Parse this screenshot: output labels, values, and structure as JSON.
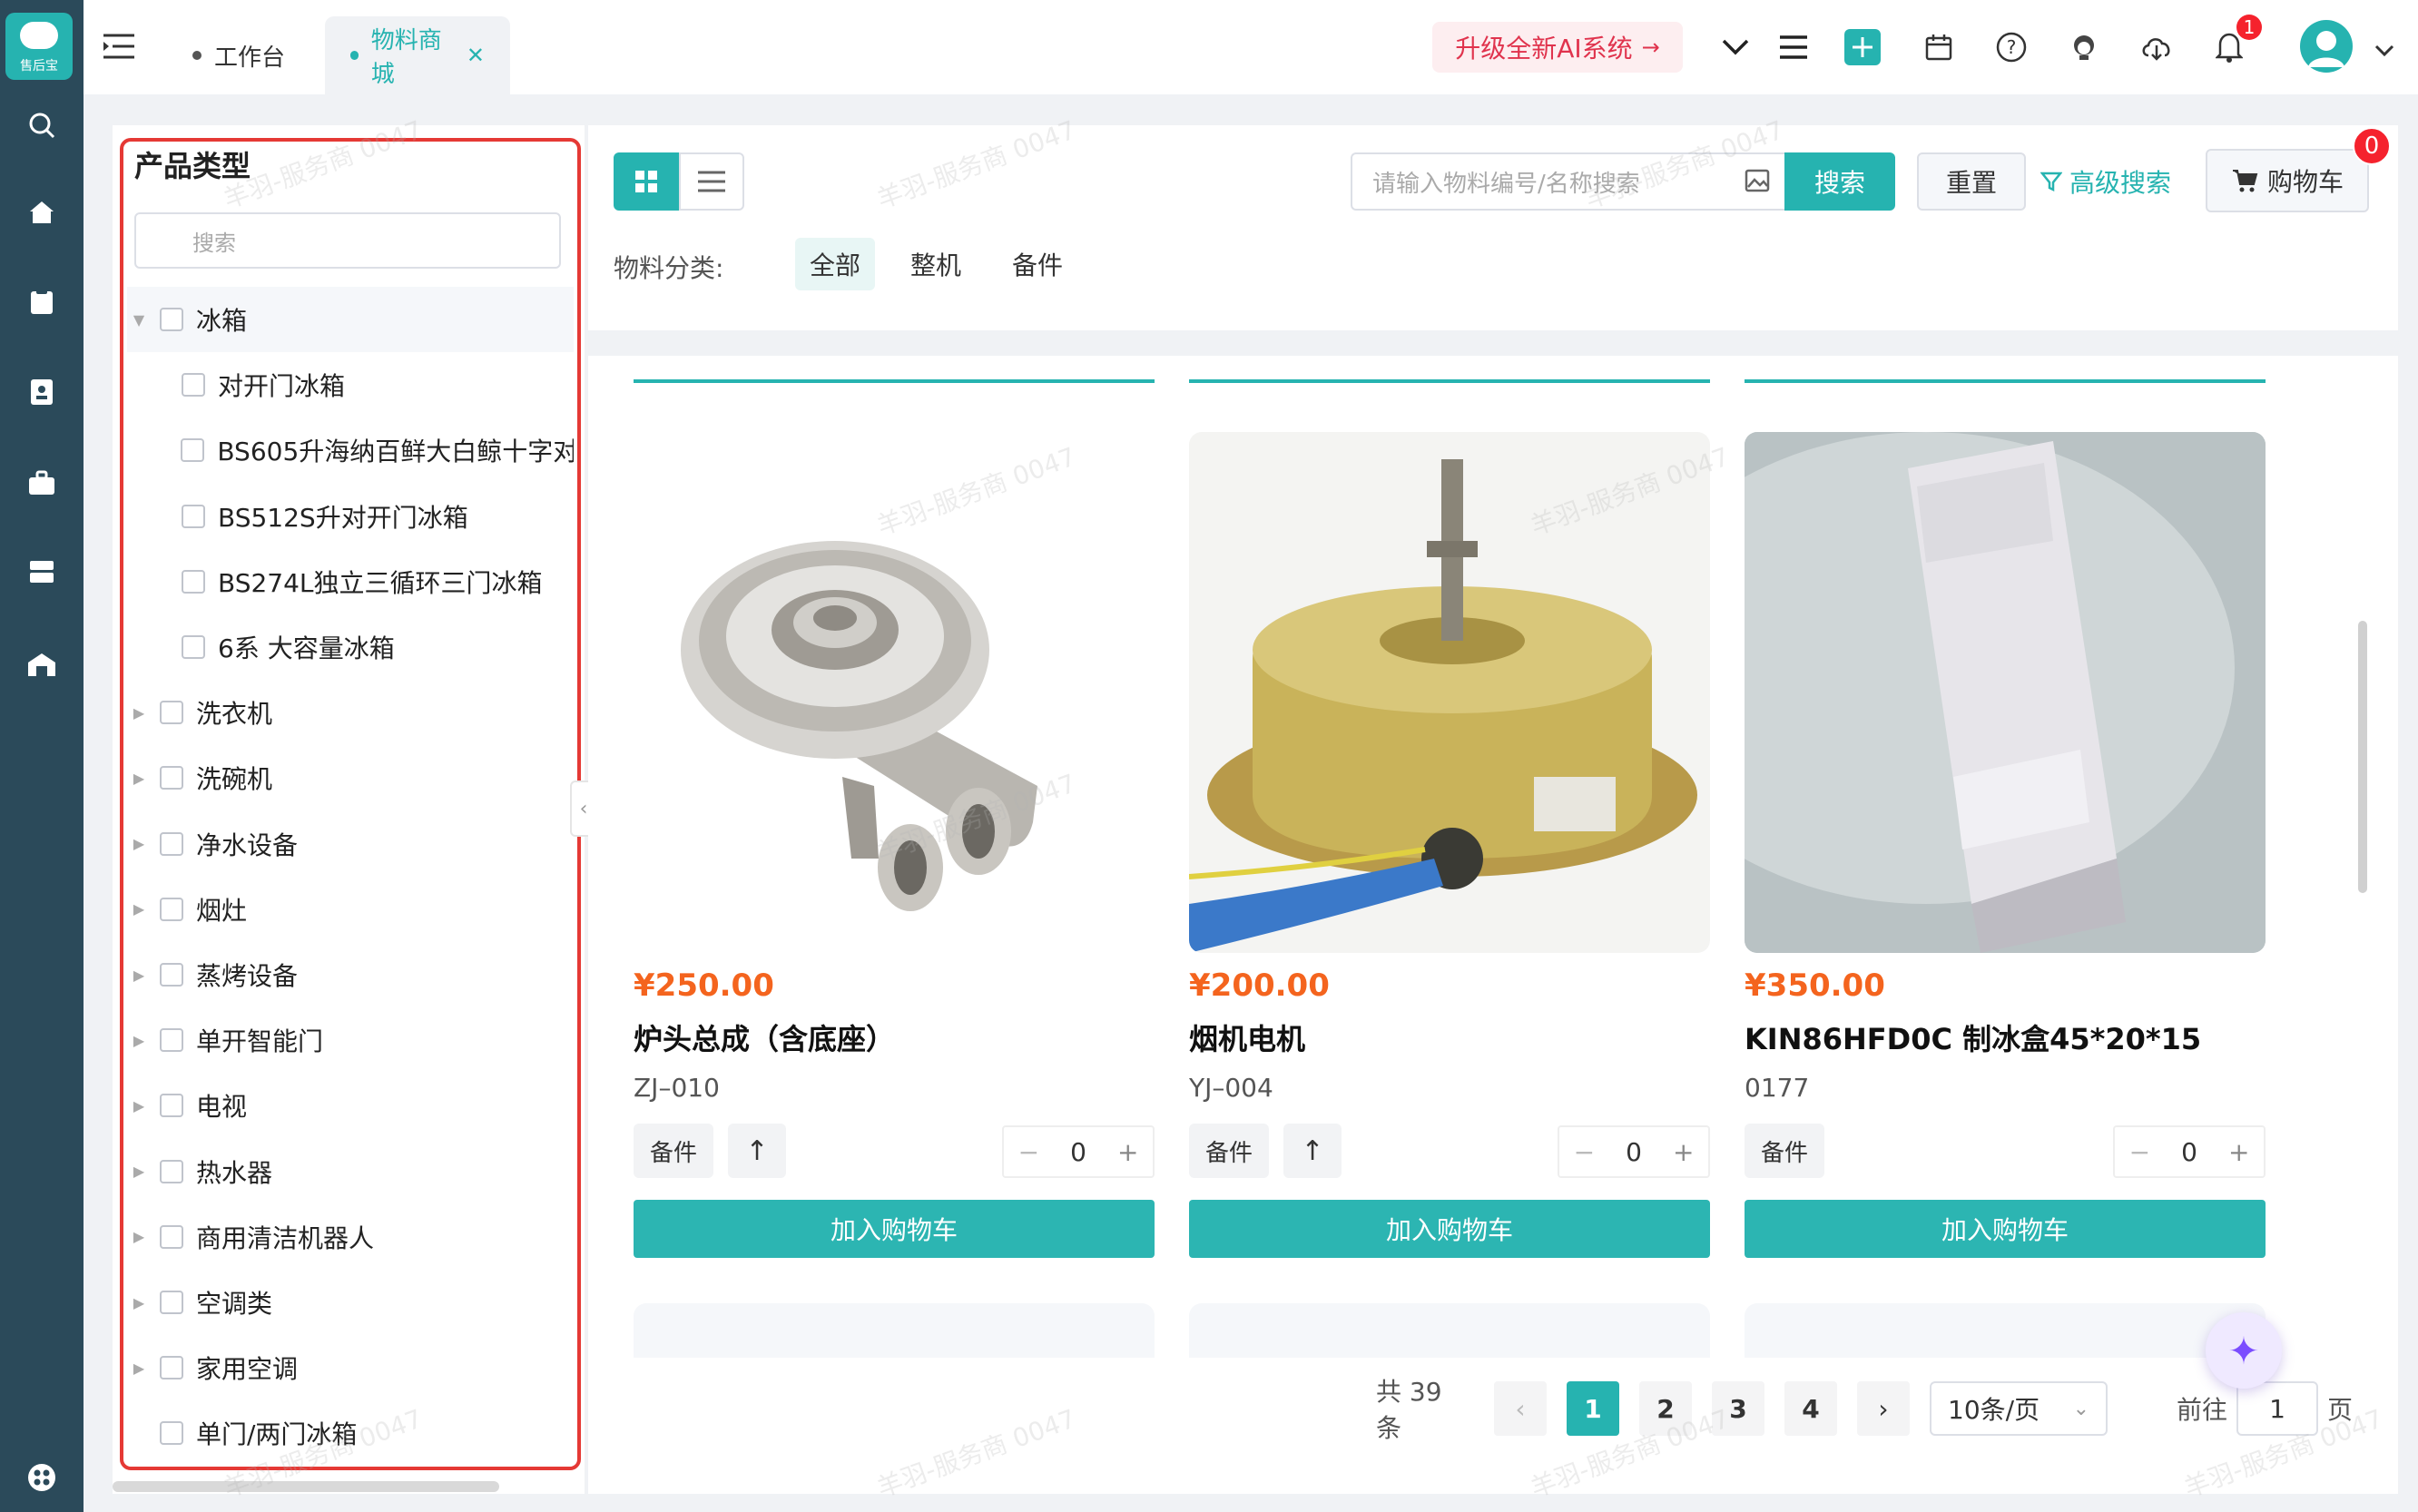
{
  "app": {
    "logo_text": "售后宝"
  },
  "tabs": [
    {
      "label": "工作台"
    },
    {
      "label": "物料商城"
    }
  ],
  "header": {
    "upgrade_label": "升级全新AI系统",
    "notification_count": "1"
  },
  "left": {
    "title": "产品类型",
    "search_placeholder": "搜索",
    "items": [
      {
        "label": "冰箱",
        "level": 0,
        "expanded": true
      },
      {
        "label": "对开门冰箱",
        "level": 1
      },
      {
        "label": "BS605升海纳百鲜大白鲸十字对",
        "level": 1
      },
      {
        "label": "BS512S升对开门冰箱",
        "level": 1
      },
      {
        "label": "BS274L独立三循环三门冰箱",
        "level": 1
      },
      {
        "label": "6系 大容量冰箱",
        "level": 1
      },
      {
        "label": "洗衣机",
        "level": 0
      },
      {
        "label": "洗碗机",
        "level": 0
      },
      {
        "label": "净水设备",
        "level": 0
      },
      {
        "label": "烟灶",
        "level": 0
      },
      {
        "label": "蒸烤设备",
        "level": 0
      },
      {
        "label": "单开智能门",
        "level": 0
      },
      {
        "label": "电视",
        "level": 0
      },
      {
        "label": "热水器",
        "level": 0
      },
      {
        "label": "商用清洁机器人",
        "level": 0
      },
      {
        "label": "空调类",
        "level": 0
      },
      {
        "label": "家用空调",
        "level": 0
      },
      {
        "label": "单门/两门冰箱",
        "level": 0
      }
    ]
  },
  "toolbar": {
    "search_placeholder": "请输入物料编号/名称搜索",
    "search_label": "搜索",
    "reset_label": "重置",
    "advanced_label": "高级搜索",
    "cart_label": "购物车",
    "cart_count": "0",
    "category_label": "物料分类:",
    "categories": [
      "全部",
      "整机",
      "备件"
    ]
  },
  "products": [
    {
      "price": "¥250.00",
      "name": "炉头总成（含底座）",
      "code": "ZJ–010",
      "tag": "备件",
      "qty": "0",
      "add_label": "加入购物车"
    },
    {
      "price": "¥200.00",
      "name": "烟机电机",
      "code": "YJ–004",
      "tag": "备件",
      "qty": "0",
      "add_label": "加入购物车"
    },
    {
      "price": "¥350.00",
      "name": "KIN86HFD0C 制冰盒45*20*15",
      "code": "0177",
      "tag": "备件",
      "qty": "0",
      "add_label": "加入购物车"
    }
  ],
  "pagination": {
    "total": "共 39 条",
    "pages": [
      "1",
      "2",
      "3",
      "4"
    ],
    "page_size": "10条/页",
    "goto_label": "前往",
    "goto_value": "1",
    "page_unit": "页"
  },
  "watermark": "羊羽-服务商 0047",
  "colors": {
    "primary": "#26b3b0",
    "sidebar": "#2b4a5a",
    "price": "#f4641e",
    "highlight_border": "#e53935"
  }
}
